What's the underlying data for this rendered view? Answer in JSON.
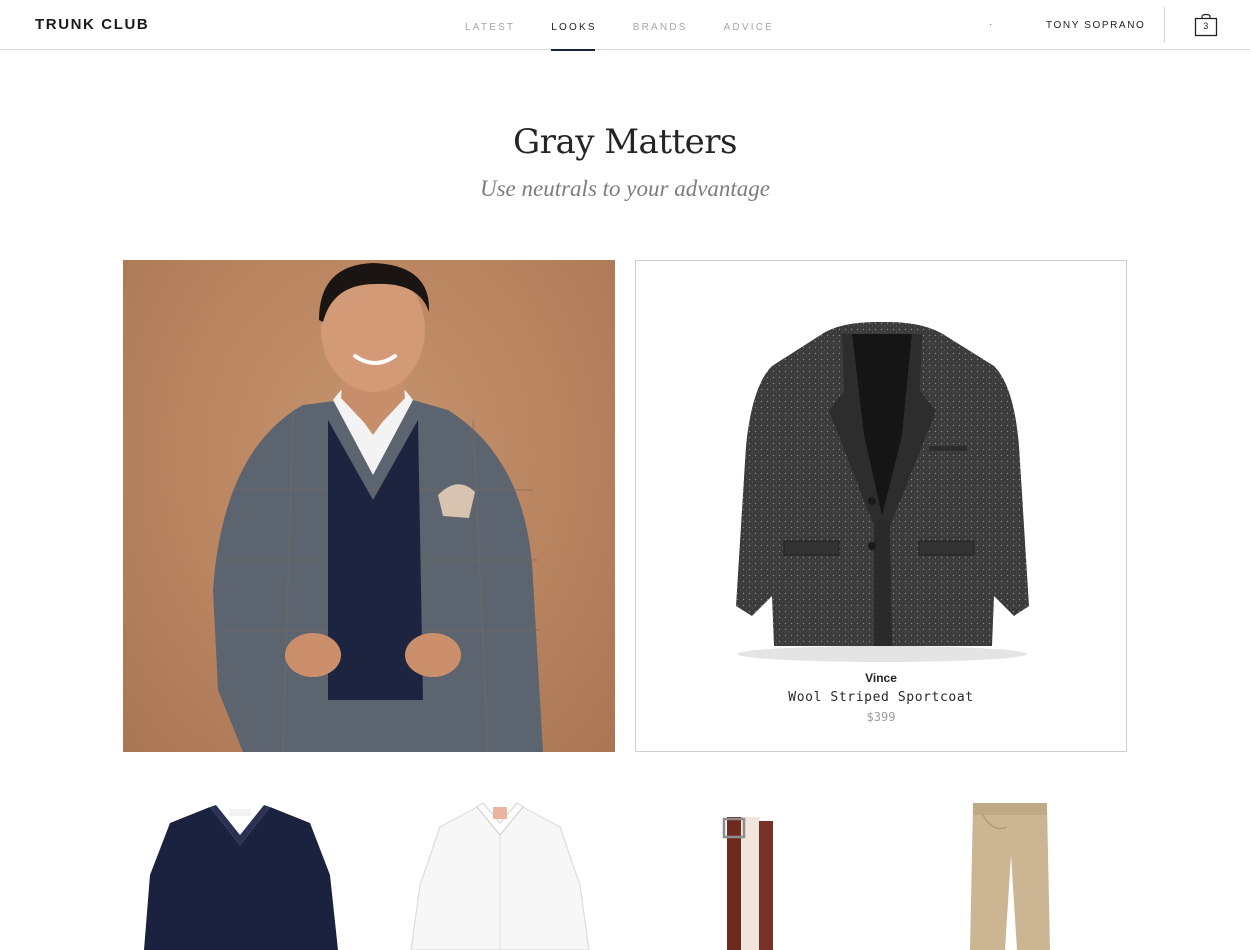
{
  "header": {
    "logo": "TRUNK CLUB",
    "nav": [
      {
        "label": "LATEST",
        "active": false
      },
      {
        "label": "LOOKS",
        "active": true
      },
      {
        "label": "BRANDS",
        "active": false
      },
      {
        "label": "ADVICE",
        "active": false
      }
    ],
    "dot": "·",
    "user_name": "TONY SOPRANO",
    "cart_count": "3"
  },
  "look": {
    "title": "Gray Matters",
    "subtitle": "Use neutrals to your advantage"
  },
  "featured": {
    "brand": "Vince",
    "name": "Wool Striped Sportcoat",
    "price": "$399"
  },
  "products": [
    {
      "icon": "navy-v-neck-sweater"
    },
    {
      "icon": "white-dress-shirt"
    },
    {
      "icon": "brown-leather-belt"
    },
    {
      "icon": "khaki-pants"
    }
  ],
  "colors": {
    "nav_underline": "#16273a",
    "hero_background": "#b98460",
    "sportcoat": "#3b3b3b"
  }
}
